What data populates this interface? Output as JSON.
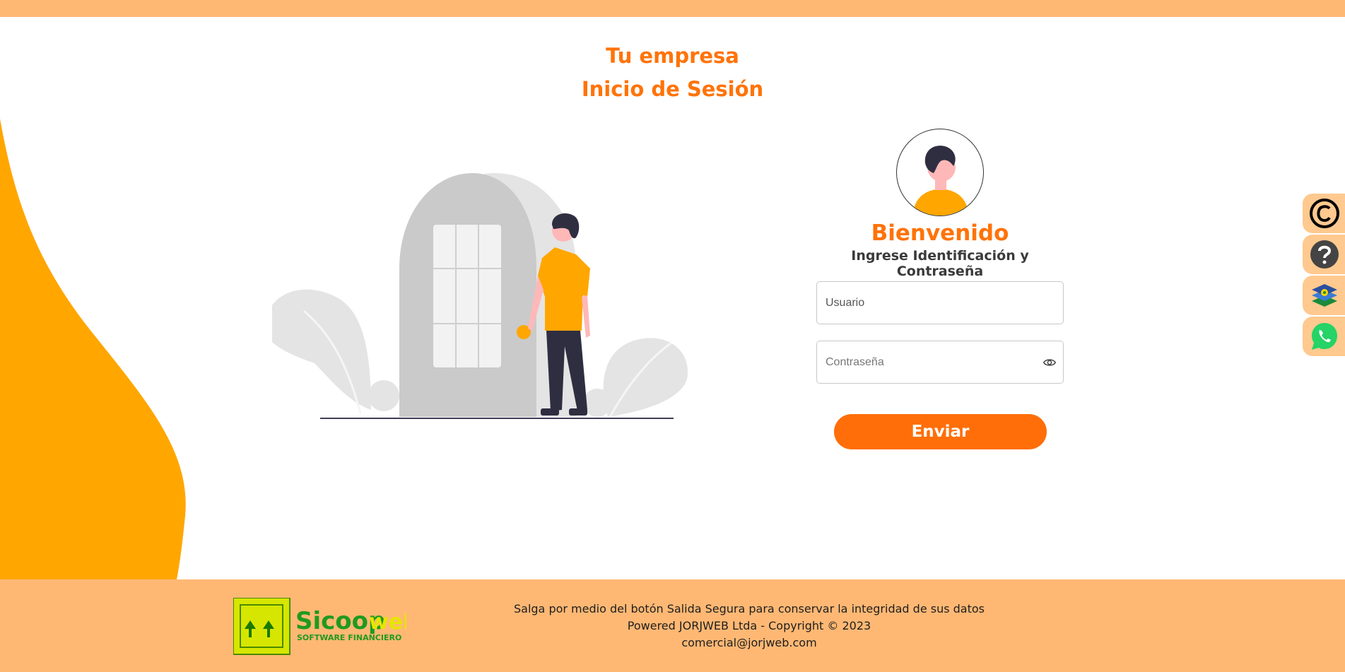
{
  "header": {
    "company": "Tu empresa",
    "title": "Inicio de Sesión"
  },
  "login": {
    "welcome": "Bienvenido",
    "subtitle": "Ingrese Identificación y Contraseña",
    "username_placeholder": "Usuario",
    "password_placeholder": "Contraseña",
    "submit_label": "Enviar"
  },
  "side_tabs": [
    {
      "icon": "copyright-icon"
    },
    {
      "icon": "help-icon"
    },
    {
      "icon": "layers-icon"
    },
    {
      "icon": "whatsapp-icon"
    }
  ],
  "footer": {
    "logo_text": "SicoopWeB",
    "logo_tagline": "SOFTWARE FINANCIERO",
    "line1": "Salga por medio del botón Salida Segura para conservar la integridad de sus datos",
    "line2": "Powered JORJWEB Ltda - Copyright © 2023",
    "line3": "comercial@jorjweb.com"
  },
  "colors": {
    "accent": "#ff7308",
    "wave": "#ffa600",
    "bars": "#ffb874",
    "button": "#ff6e08"
  }
}
